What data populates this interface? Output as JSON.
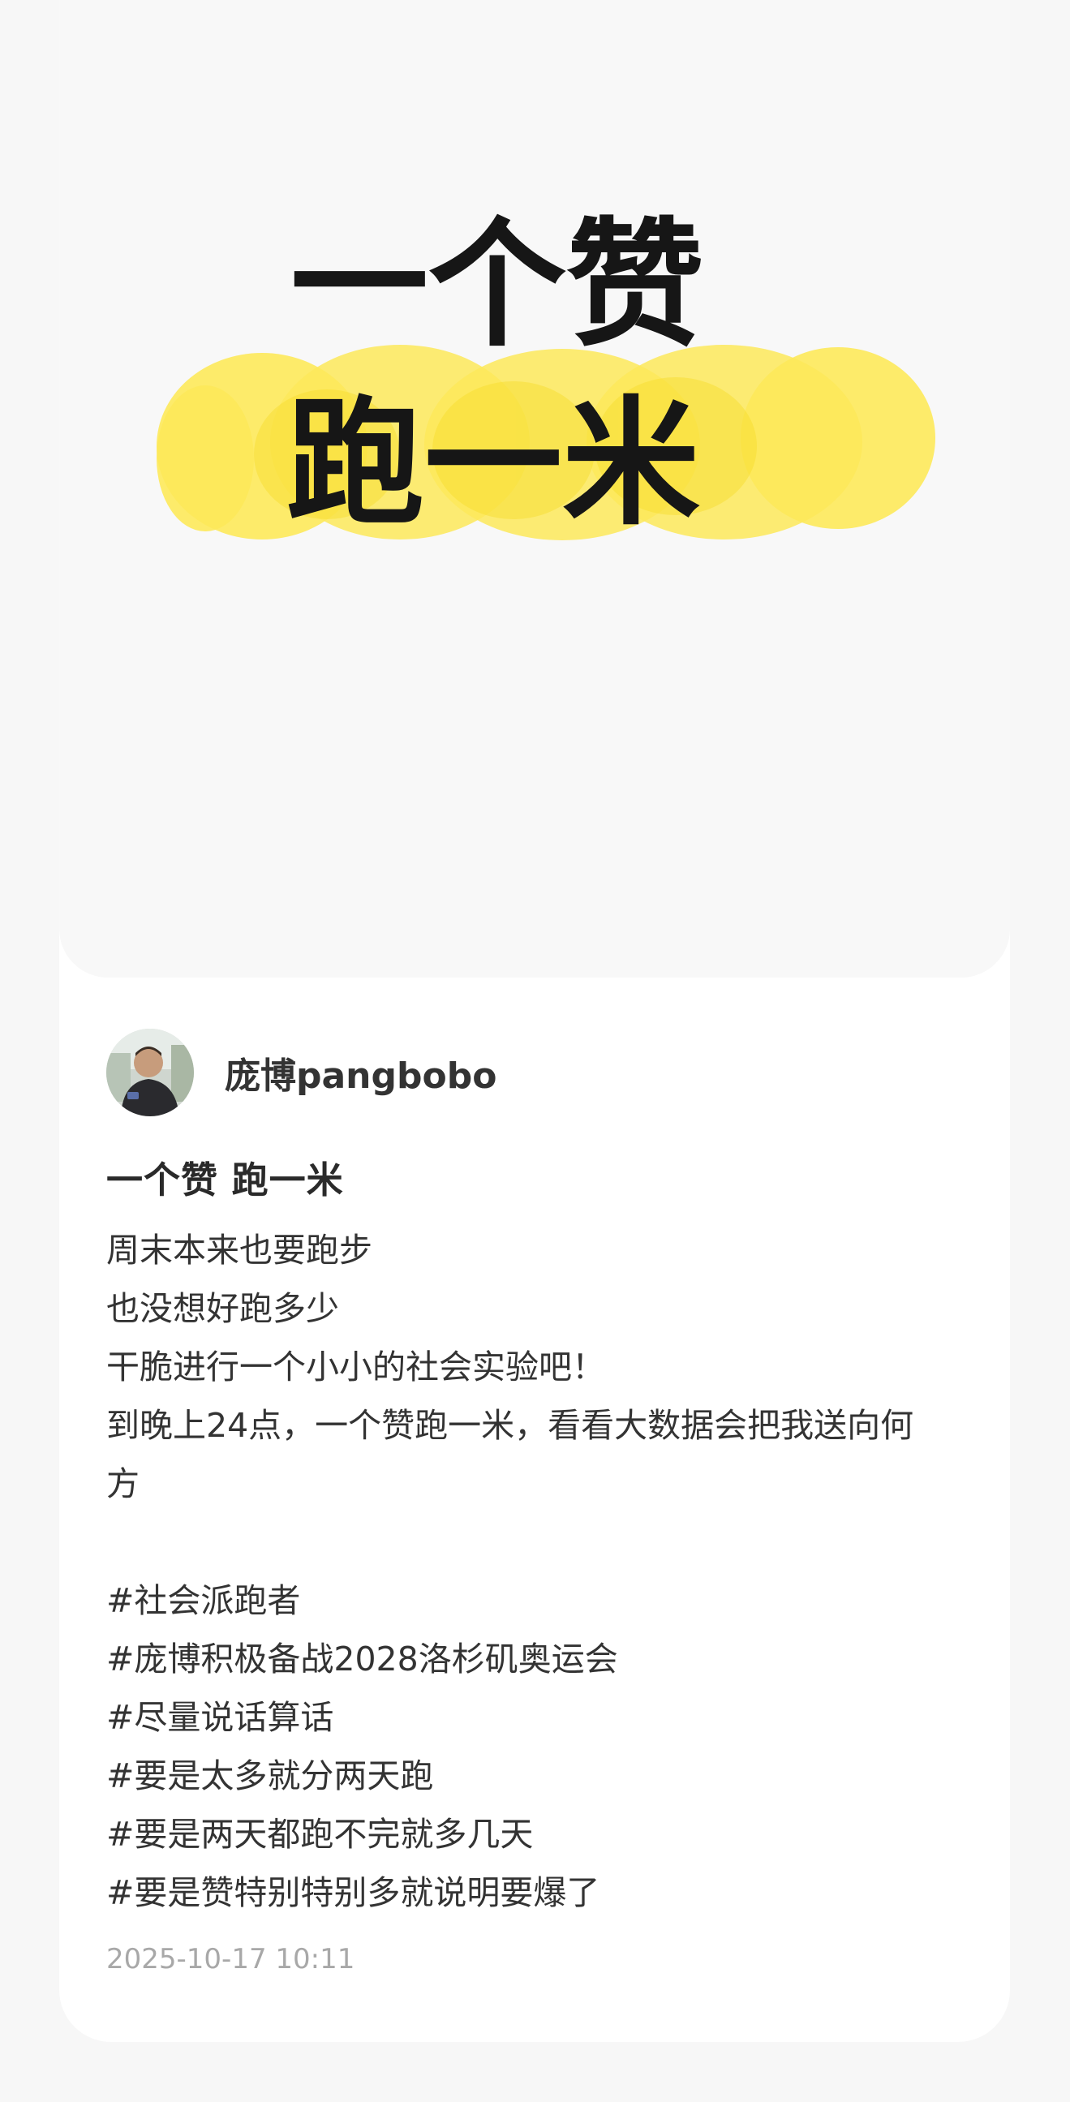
{
  "cover": {
    "line1": "一个赞",
    "line2": "跑一米",
    "highlight_color": "#fde95a"
  },
  "author": {
    "name": "庞博pangbobo"
  },
  "post": {
    "title": "一个赞 跑一米",
    "lines": [
      "周末本来也要跑步",
      "也没想好跑多少",
      "干脆进行一个小小的社会实验吧！",
      "到晚上24点，一个赞跑一米，看看大数据会把我送向何",
      "方"
    ],
    "hashtags": [
      "#社会派跑者",
      "#庞博积极备战2028洛杉矶奥运会",
      "#尽量说话算话",
      "#要是太多就分两天跑",
      "#要是两天都跑不完就多几天",
      "#要是赞特别特别多就说明要爆了"
    ],
    "date": "2025-10-17 10:11"
  }
}
